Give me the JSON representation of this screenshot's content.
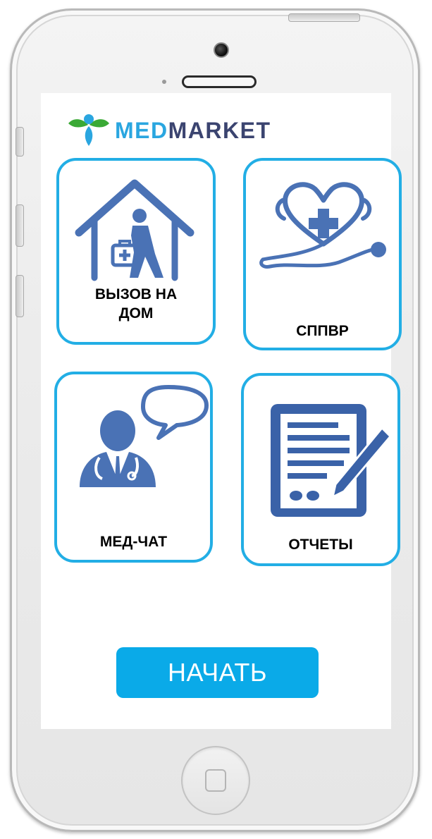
{
  "app": {
    "logo_part1": "MED",
    "logo_part2": "MARKET",
    "brand_colors": {
      "med": "#2aa6e0",
      "market": "#3b4470",
      "accent": "#22aee5",
      "icon": "#4a72b5"
    }
  },
  "tiles": [
    {
      "label_line1": "ВЫЗОВ НА",
      "label_line2": "ДОМ",
      "icon": "house-call-icon"
    },
    {
      "label": "СППВР",
      "icon": "stethoscope-heart-icon"
    },
    {
      "label": "МЕД-ЧАТ",
      "icon": "doctor-chat-icon"
    },
    {
      "label": "ОТЧЕТЫ",
      "icon": "report-document-icon"
    }
  ],
  "start_button": {
    "label": "НАЧАТЬ",
    "color": "#0aaae8"
  }
}
